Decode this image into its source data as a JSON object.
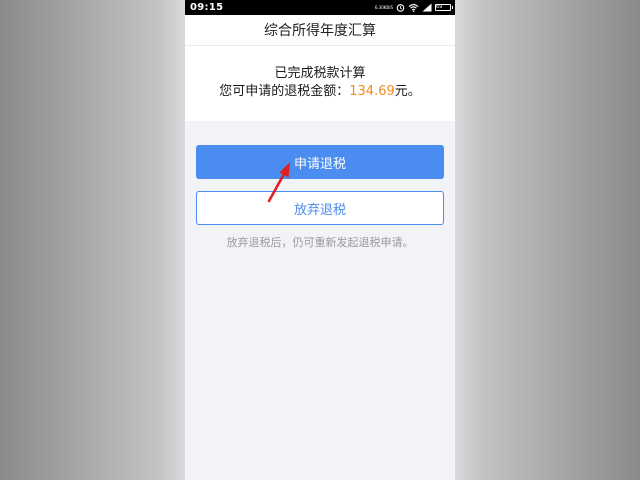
{
  "status_bar": {
    "time": "09:15",
    "speed_value": "6.30",
    "speed_unit": "KB/S",
    "battery_level": "69"
  },
  "header": {
    "title": "综合所得年度汇算"
  },
  "result": {
    "line1": "已完成税款计算",
    "line2_prefix": "您可申请的退税金额：",
    "amount": "134.69",
    "line2_suffix": "元。"
  },
  "actions": {
    "apply_label": "申请退税",
    "abandon_label": "放弃退税",
    "hint": "放弃退税后，仍可重新发起退税申请。"
  },
  "colors": {
    "primary": "#4a8cf0",
    "amount": "#f08c1c",
    "annotation_arrow": "#e02020"
  },
  "icons": [
    "alarm-icon",
    "wifi-icon",
    "signal-icon",
    "battery-icon"
  ]
}
